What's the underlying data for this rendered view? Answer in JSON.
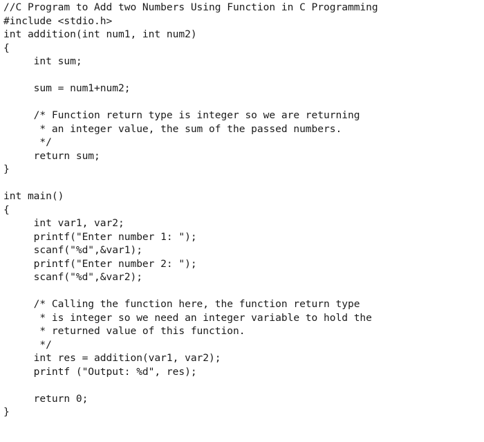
{
  "document": {
    "language": "C",
    "lines": [
      "//C Program to Add two Numbers Using Function in C Programming",
      "#include <stdio.h>",
      "int addition(int num1, int num2)",
      "{",
      "     int sum;",
      "",
      "     sum = num1+num2;",
      "",
      "     /* Function return type is integer so we are returning",
      "      * an integer value, the sum of the passed numbers.",
      "      */",
      "     return sum;",
      "}",
      "",
      "int main()",
      "{",
      "     int var1, var2;",
      "     printf(\"Enter number 1: \");",
      "     scanf(\"%d\",&var1);",
      "     printf(\"Enter number 2: \");",
      "     scanf(\"%d\",&var2);",
      "",
      "     /* Calling the function here, the function return type",
      "      * is integer so we need an integer variable to hold the",
      "      * returned value of this function.",
      "      */",
      "     int res = addition(var1, var2);",
      "     printf (\"Output: %d\", res);",
      "",
      "     return 0;",
      "}"
    ]
  }
}
